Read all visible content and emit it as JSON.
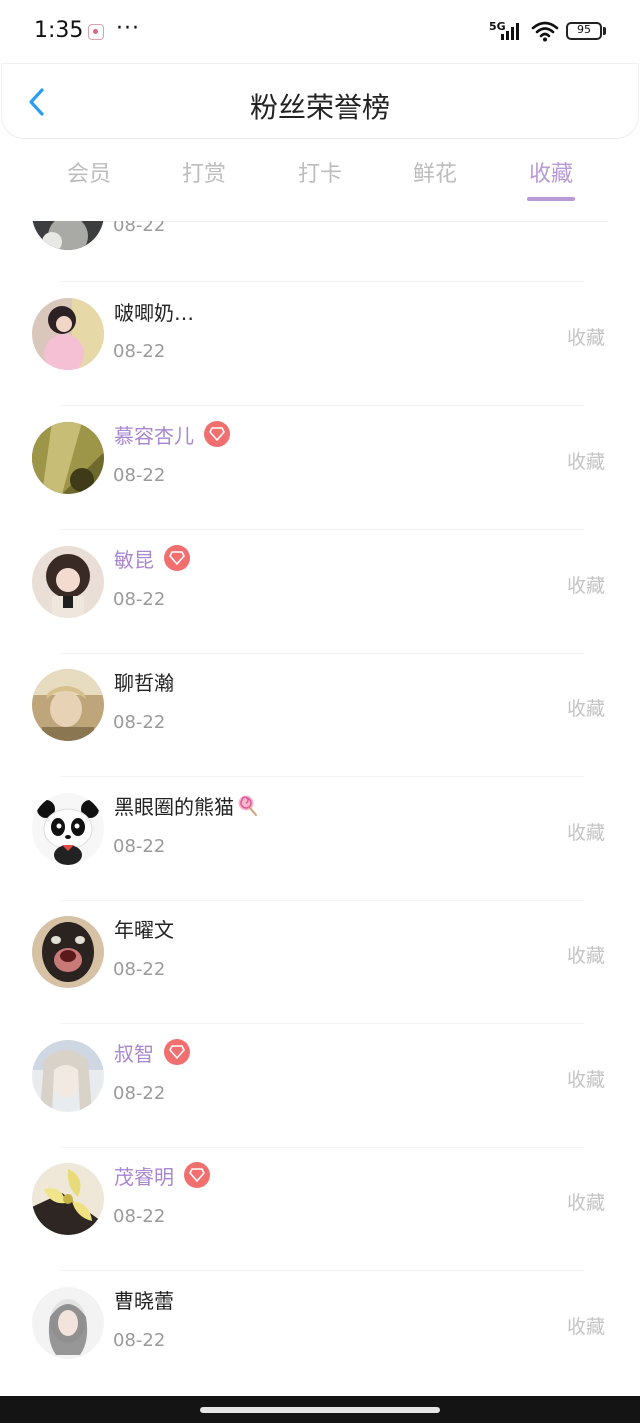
{
  "status_bar": {
    "time": "1:35",
    "more": "···",
    "network": "5G",
    "battery": "95",
    "icons": [
      "app-notification-icon",
      "signal-icon",
      "wifi-icon",
      "battery-icon"
    ]
  },
  "header": {
    "title": "粉丝荣誉榜",
    "back_icon": "chevron-left-icon"
  },
  "tabs": [
    {
      "label": "会员",
      "active": false
    },
    {
      "label": "打赏",
      "active": false
    },
    {
      "label": "打卡",
      "active": false
    },
    {
      "label": "鲜花",
      "active": false
    },
    {
      "label": "收藏",
      "active": true
    }
  ],
  "colors": {
    "accent": "#b89ad6",
    "vip_name": "#a987d0",
    "vip_badge": "#f26f6f",
    "muted": "#9a9a9a",
    "action": "#c4c4c4"
  },
  "fans": [
    {
      "name": "",
      "date": "08-22",
      "action": "",
      "vip": false
    },
    {
      "name": "啵唧奶…",
      "date": "08-22",
      "action": "收藏",
      "vip": false
    },
    {
      "name": "慕容杏儿",
      "date": "08-22",
      "action": "收藏",
      "vip": true
    },
    {
      "name": "敏昆",
      "date": "08-22",
      "action": "收藏",
      "vip": true
    },
    {
      "name": "聊哲瀚",
      "date": "08-22",
      "action": "收藏",
      "vip": false
    },
    {
      "name": "黑眼圈的熊猫",
      "date": "08-22",
      "action": "收藏",
      "vip": false,
      "emoji": "lollipop-icon"
    },
    {
      "name": "年曜文",
      "date": "08-22",
      "action": "收藏",
      "vip": false
    },
    {
      "name": "叔智",
      "date": "08-22",
      "action": "收藏",
      "vip": true
    },
    {
      "name": "茂睿明",
      "date": "08-22",
      "action": "收藏",
      "vip": true
    },
    {
      "name": "曹晓蕾",
      "date": "08-22",
      "action": "收藏",
      "vip": false
    }
  ]
}
